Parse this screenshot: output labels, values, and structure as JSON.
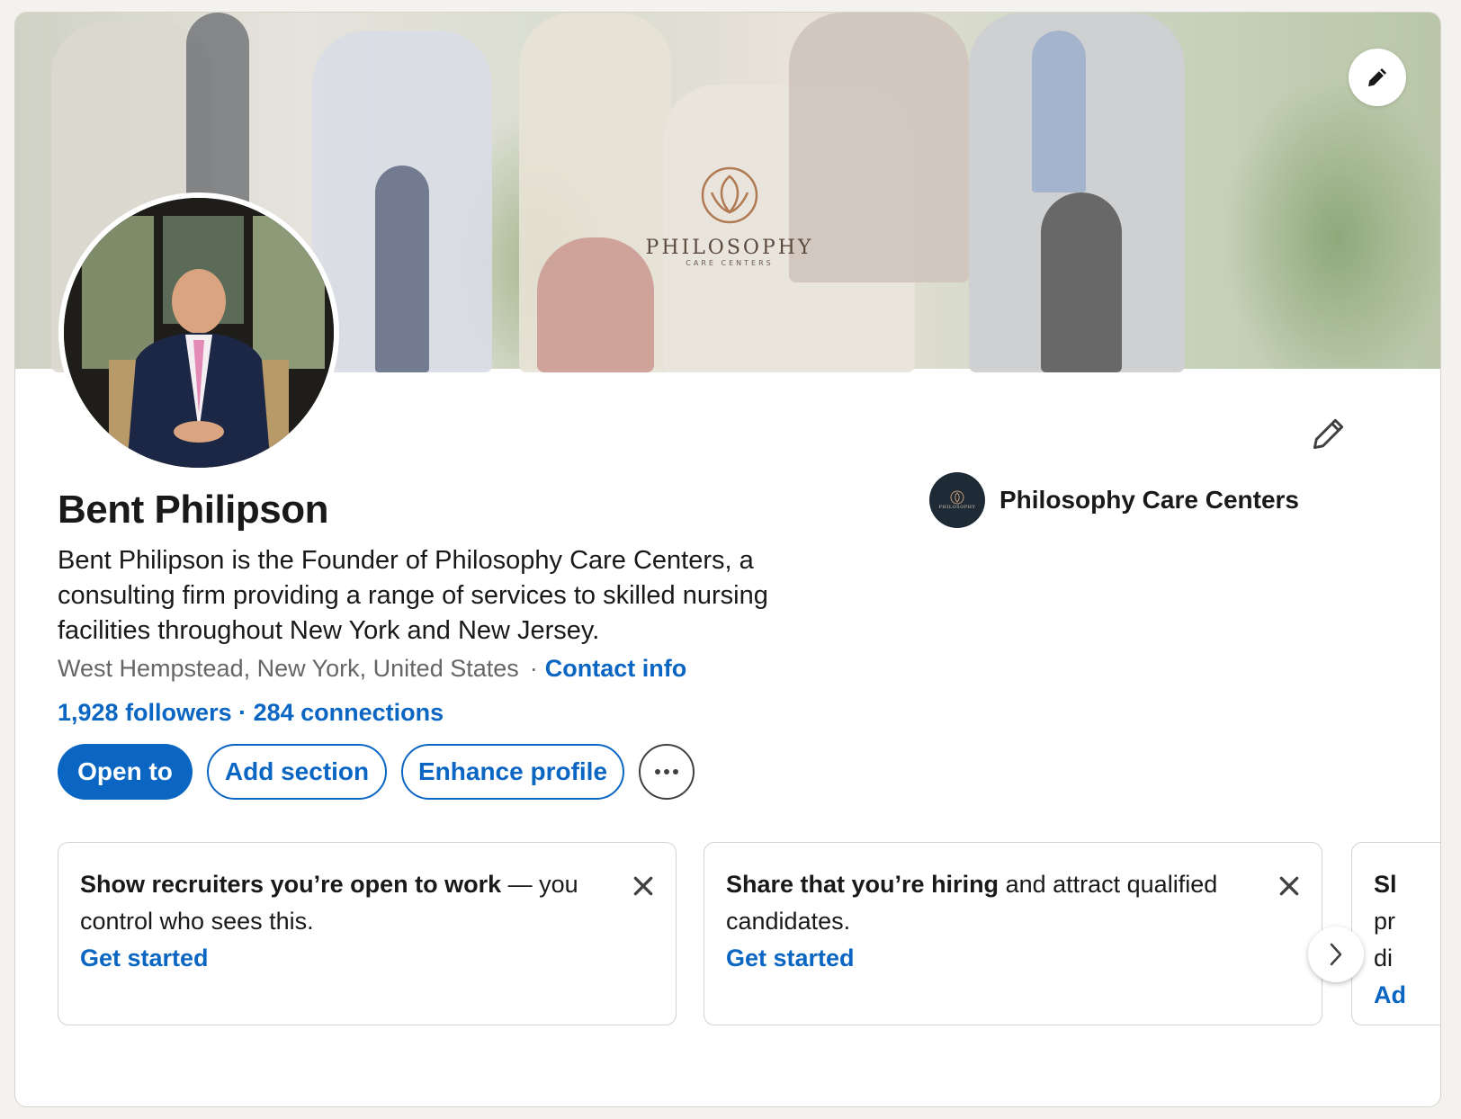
{
  "profile": {
    "name": "Bent Philipson",
    "headline": "Bent Philipson is the Founder of Philosophy Care Centers, a consulting firm providing a range of services to skilled nursing facilities throughout New York and New Jersey.",
    "location": "West Hempstead, New York, United States",
    "separator": "·",
    "contact_info": "Contact info",
    "followers": "1,928 followers",
    "connections": "284 connections",
    "network_separator": " · "
  },
  "cover": {
    "brand_name": "PHILOSOPHY",
    "brand_sub": "CARE CENTERS"
  },
  "company": {
    "name": "Philosophy Care Centers",
    "logo_text": "PHILOSOPHY"
  },
  "actions": {
    "open_to": "Open to",
    "add_section": "Add section",
    "enhance_profile": "Enhance profile",
    "more": "···"
  },
  "suggestions": [
    {
      "bold": "Show recruiters you’re open to work",
      "rest": " — you control who sees this.",
      "cta": "Get started"
    },
    {
      "bold": "Share that you’re hiring",
      "rest": " and attract qualified candidates.",
      "cta": "Get started"
    },
    {
      "partial_lines": [
        "Sl",
        "pr",
        "di",
        "Ad"
      ]
    }
  ],
  "icons": {
    "cover_edit": "pencil-icon",
    "profile_edit": "pencil-icon",
    "close": "close-icon",
    "next": "chevron-right-icon"
  },
  "colors": {
    "brand_blue": "#0a66c2",
    "text": "#191919",
    "muted": "#666666",
    "page_bg": "#f3f2ef"
  }
}
